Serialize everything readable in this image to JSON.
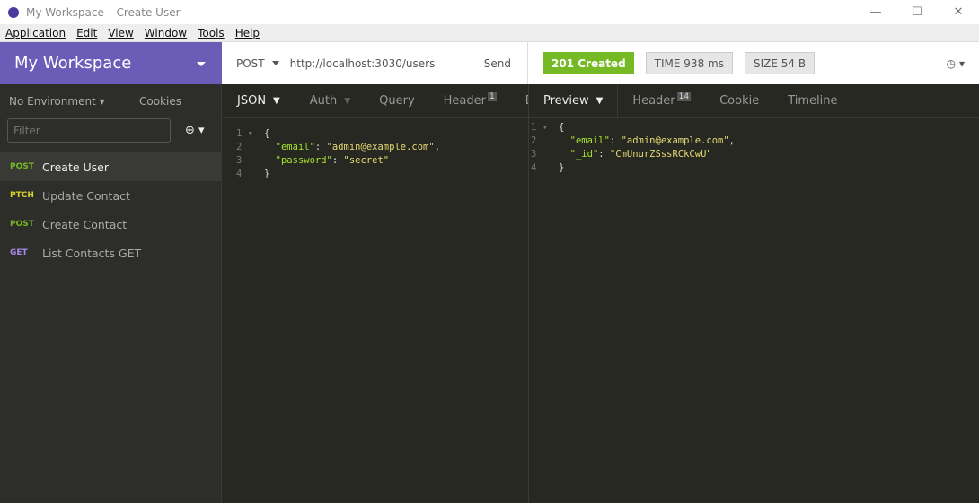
{
  "window": {
    "title": "My Workspace – Create User",
    "controls": [
      "—",
      "☐",
      "✕"
    ]
  },
  "menu": [
    "Application",
    "Edit",
    "View",
    "Window",
    "Tools",
    "Help"
  ],
  "workspace": {
    "name": "My Workspace"
  },
  "sidebar": {
    "environment": "No Environment",
    "cookies": "Cookies",
    "filter_placeholder": "Filter",
    "items": [
      {
        "method": "POST",
        "color": "#75ba24",
        "label": "Create User",
        "selected": true
      },
      {
        "method": "PTCH",
        "color": "#d8d22e",
        "label": "Update Contact"
      },
      {
        "method": "POST",
        "color": "#75ba24",
        "label": "Create Contact"
      },
      {
        "method": "GET",
        "color": "#a78ae6",
        "label": "List Contacts GET"
      }
    ]
  },
  "request": {
    "method": "POST",
    "url": "http://localhost:3030/users",
    "send": "Send",
    "tabs": [
      {
        "label": "JSON"
      },
      {
        "label": "Auth"
      },
      {
        "label": "Query"
      },
      {
        "label": "Header",
        "count": "1"
      },
      {
        "label": "D"
      }
    ],
    "body": [
      [
        "{"
      ],
      [
        "  ",
        "\"email\"",
        ": ",
        "\"admin@example.com\"",
        ","
      ],
      [
        "  ",
        "\"password\"",
        ": ",
        "\"secret\""
      ],
      [
        "}"
      ]
    ]
  },
  "response": {
    "status": "201 Created",
    "status_color": "#75ba24",
    "time_label": "TIME",
    "time": "938 ms",
    "size_label": "SIZE",
    "size": "54 B",
    "tabs": [
      {
        "label": "Preview"
      },
      {
        "label": "Header",
        "count": "14"
      },
      {
        "label": "Cookie"
      },
      {
        "label": "Timeline"
      }
    ],
    "body": [
      [
        "{"
      ],
      [
        "  ",
        "\"email\"",
        ": ",
        "\"admin@example.com\"",
        ","
      ],
      [
        "  ",
        "\"_id\"",
        ": ",
        "\"CmUnurZSssRCkCwU\""
      ],
      [
        "}"
      ]
    ]
  }
}
